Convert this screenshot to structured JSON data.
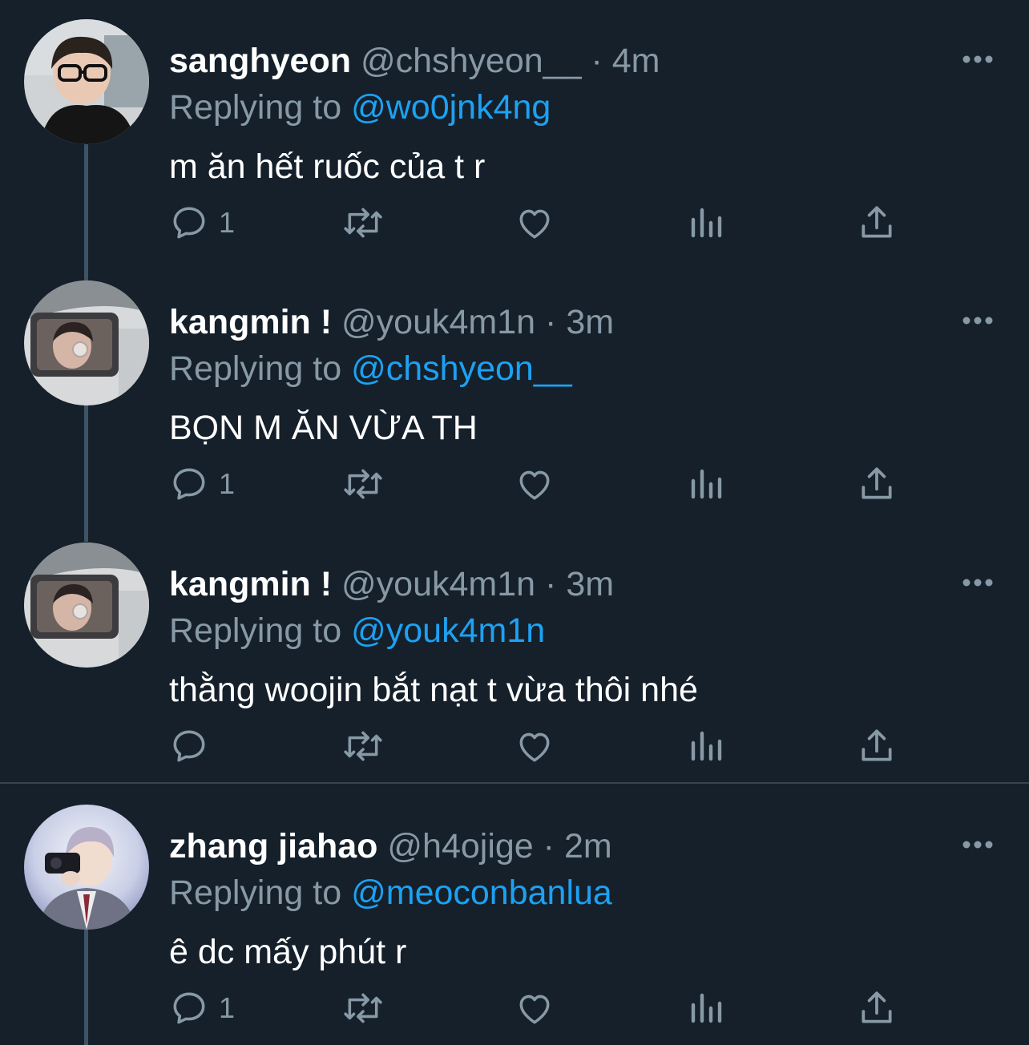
{
  "tweets": [
    {
      "name": "sanghyeon",
      "handle": "@chshyeon__",
      "dot": "·",
      "time": "4m",
      "replying_prefix": "Replying to",
      "replying_to": "@wo0jnk4ng",
      "text": "m ăn hết ruốc của t r",
      "reply_count": "1"
    },
    {
      "name": "kangmin !",
      "handle": "@youk4m1n",
      "dot": "·",
      "time": "3m",
      "replying_prefix": "Replying to",
      "replying_to": "@chshyeon__",
      "text": "BỌN M ĂN VỪA TH",
      "reply_count": "1"
    },
    {
      "name": "kangmin !",
      "handle": "@youk4m1n",
      "dot": "·",
      "time": "3m",
      "replying_prefix": "Replying to",
      "replying_to": "@youk4m1n",
      "text": "thằng woojin bắt nạt t vừa thôi nhé",
      "reply_count": ""
    },
    {
      "name": "zhang jiahao",
      "handle": "@h4ojige",
      "dot": "·",
      "time": "2m",
      "replying_prefix": "Replying to",
      "replying_to": "@meoconbanlua",
      "text": "ê dc mấy phút r",
      "reply_count": "1"
    }
  ],
  "colors": {
    "background": "#15202b",
    "secondary_text": "#8899a6",
    "link": "#1da1f2",
    "thread_line": "#3d5466"
  },
  "icons": [
    "more-icon",
    "reply-icon",
    "retweet-icon",
    "like-icon",
    "analytics-icon",
    "share-icon"
  ]
}
